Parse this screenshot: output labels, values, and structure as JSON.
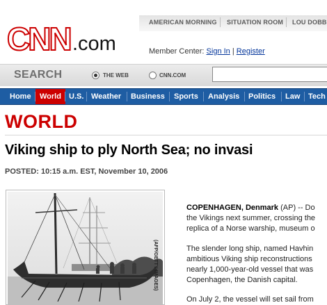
{
  "top_nav": {
    "items": [
      "AMERICAN MORNING",
      "SITUATION ROOM",
      "LOU DOBBS"
    ]
  },
  "logo": {
    "brand": "CNN",
    "suffix": ".com"
  },
  "member": {
    "prefix": "Member Center:",
    "sign_in": "Sign In",
    "separator": "|",
    "register": "Register"
  },
  "search": {
    "label": "SEARCH",
    "options": [
      {
        "label": "THE WEB",
        "selected": true
      },
      {
        "label": "CNN.COM",
        "selected": false
      }
    ],
    "value": ""
  },
  "main_nav": {
    "items": [
      "Home",
      "World",
      "U.S.",
      "Weather",
      "Business",
      "Sports",
      "Analysis",
      "Politics",
      "Law",
      "Tech"
    ],
    "active": "World"
  },
  "section_title": "WORLD",
  "headline": "Viking ship to ply North Sea; no invasi",
  "posted": "POSTED: 10:15 a.m. EST, November 10, 2006",
  "photo": {
    "credit": "(AFP/GETTY IMAGES)"
  },
  "article": {
    "dateline": "COPENHAGEN, Denmark",
    "paragraphs": [
      [
        " (AP) -- Do",
        "the Vikings next summer, crossing the",
        "replica of a Norse warship, museum o"
      ],
      [
        "The slender long ship, named Havhin",
        "ambitious Viking ship reconstructions",
        "nearly 1,000-year-old vessel that was",
        "Copenhagen, the Danish capital."
      ],
      [
        "On July 2, the vessel will set sail from"
      ]
    ]
  },
  "colors": {
    "brand_red": "#cc0000",
    "nav_blue": "#1e5da3",
    "link_blue": "#003399"
  }
}
